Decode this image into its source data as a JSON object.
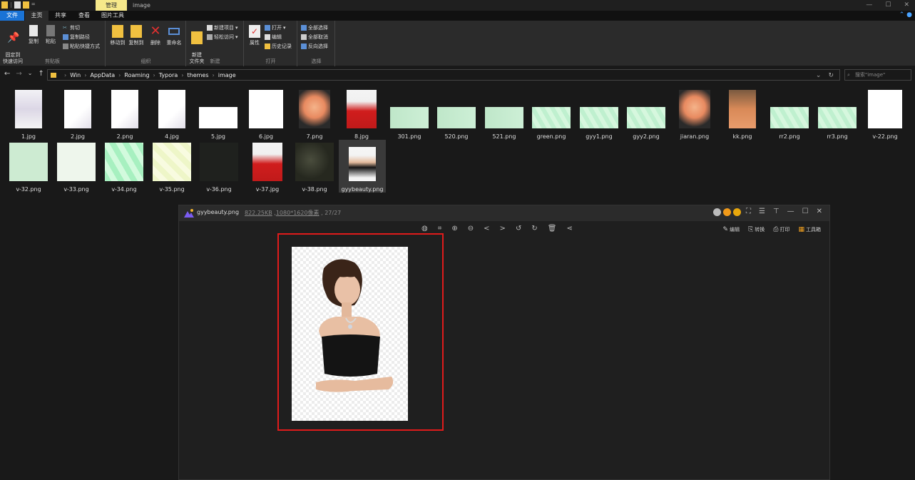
{
  "window": {
    "title": "image",
    "context_tab": "管理",
    "controls": [
      "—",
      "☐",
      "✕"
    ]
  },
  "menu": {
    "file": "文件",
    "home": "主页",
    "share": "共享",
    "view": "查看",
    "picture_tools": "图片工具"
  },
  "ribbon": {
    "pin": "固定到\n快速访问",
    "copy": "复制",
    "paste": "粘贴",
    "cut": "剪切",
    "copy_path": "复制路径",
    "paste_shortcut": "粘贴快捷方式",
    "clipboard_group": "剪贴板",
    "move_to": "移动到",
    "copy_to": "复制到",
    "delete": "删除",
    "rename": "重命名",
    "organize_group": "组织",
    "new_folder": "新建\n文件夹",
    "new_item": "新建项目",
    "easy_access": "轻松访问",
    "new_group": "新建",
    "properties": "属性",
    "open": "打开",
    "edit": "编辑",
    "history": "历史记录",
    "open_group": "打开",
    "select_all": "全部选择",
    "select_none": "全部取消",
    "invert_selection": "反向选择",
    "select_group": "选择"
  },
  "address": {
    "path": [
      "Win",
      "AppData",
      "Roaming",
      "Typora",
      "themes",
      "image"
    ],
    "search_placeholder": "搜索\"image\""
  },
  "files": [
    {
      "name": "1.jpg",
      "kind": "anime-white"
    },
    {
      "name": "2.jpg",
      "kind": "white-anime"
    },
    {
      "name": "2.png",
      "kind": "white-anime"
    },
    {
      "name": "4.jpg",
      "kind": "white-anime"
    },
    {
      "name": "5.jpg",
      "kind": "white-wide"
    },
    {
      "name": "6.jpg",
      "kind": "white"
    },
    {
      "name": "7.png",
      "kind": "anime-orange"
    },
    {
      "name": "8.jpg",
      "kind": "red-dress"
    },
    {
      "name": "301.png",
      "kind": "green-wide"
    },
    {
      "name": "520.png",
      "kind": "green-wide"
    },
    {
      "name": "521.png",
      "kind": "green-wide"
    },
    {
      "name": "green.png",
      "kind": "green-pattern"
    },
    {
      "name": "gyy1.png",
      "kind": "green-pattern"
    },
    {
      "name": "gyy2.png",
      "kind": "green-pattern"
    },
    {
      "name": "jiaran.png",
      "kind": "anime-orange"
    },
    {
      "name": "kk.png",
      "kind": "portrait-orange"
    },
    {
      "name": "rr2.png",
      "kind": "green-pattern"
    },
    {
      "name": "rr3.png",
      "kind": "green-pattern"
    },
    {
      "name": "v-22.png",
      "kind": "white"
    },
    {
      "name": "v-32.png",
      "kind": "green-solid"
    },
    {
      "name": "v-33.png",
      "kind": "pale"
    },
    {
      "name": "v-34.png",
      "kind": "green-hex"
    },
    {
      "name": "v-35.png",
      "kind": "yellow-pattern"
    },
    {
      "name": "v-36.png",
      "kind": "dark"
    },
    {
      "name": "v-37.jpg",
      "kind": "red-dress"
    },
    {
      "name": "v-38.png",
      "kind": "dark-photo"
    },
    {
      "name": "gyybeauty.png",
      "kind": "woman-black",
      "selected": true
    }
  ],
  "viewer": {
    "filename": "gyybeauty.png",
    "size": "822.25KB",
    "dimensions": "1080*1620像素",
    "index": "27/27",
    "edit": "编辑",
    "convert": "转换",
    "print": "打印",
    "toolbox": "工具箱"
  },
  "colors": {
    "accent": "#1a73d6",
    "context_tab": "#f6e88a",
    "highlight_box": "#e01b1b"
  }
}
